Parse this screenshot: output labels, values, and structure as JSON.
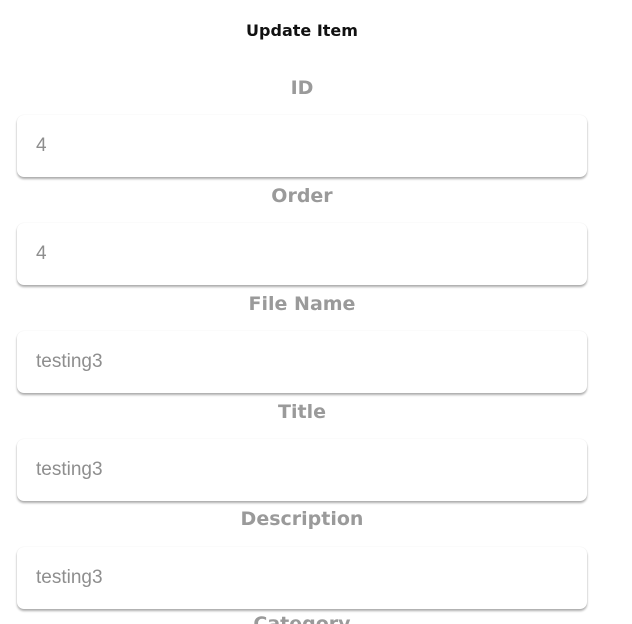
{
  "form": {
    "title": "Update Item",
    "fields": [
      {
        "label": "ID",
        "value": "4"
      },
      {
        "label": "Order",
        "value": "4"
      },
      {
        "label": "File Name",
        "value": "testing3"
      },
      {
        "label": "Title",
        "value": "testing3"
      },
      {
        "label": "Description",
        "value": "testing3"
      },
      {
        "label": "Category",
        "value": ""
      }
    ]
  }
}
